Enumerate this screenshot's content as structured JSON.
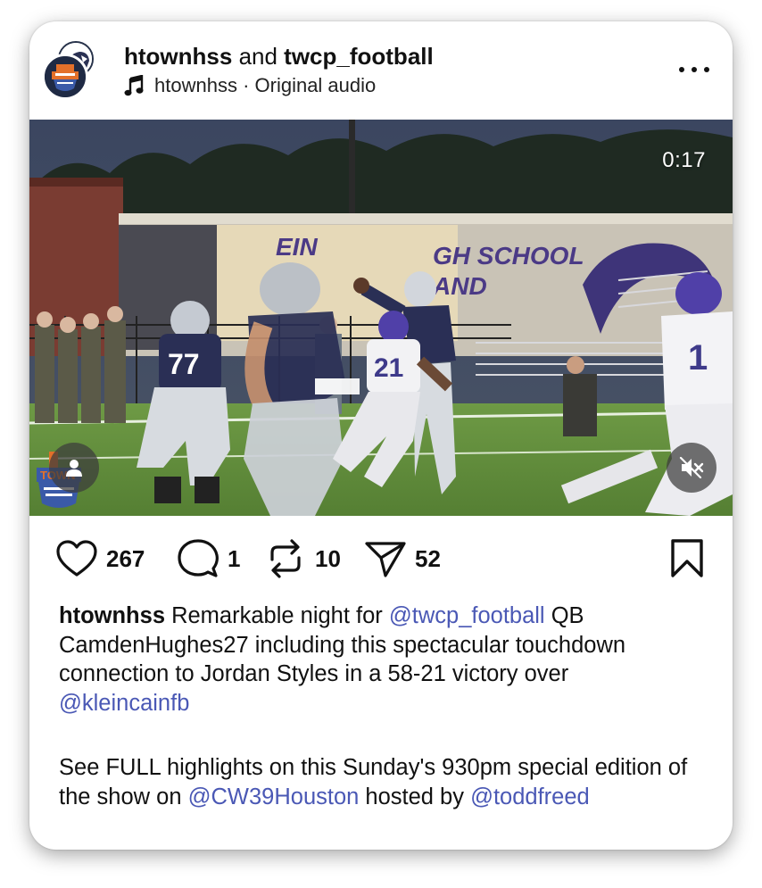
{
  "post": {
    "author_primary": "htownhss",
    "author_joiner": " and ",
    "author_secondary": "twcp_football",
    "audio_owner": "htownhss",
    "audio_sep": " · ",
    "audio_label": "Original audio"
  },
  "video": {
    "timer": "0:17",
    "overlay_signs": [
      "EIN",
      "GH SCHOOL",
      "AND"
    ],
    "jersey_numbers": [
      "77",
      "21",
      "1"
    ]
  },
  "actions": {
    "likes": "267",
    "comments": "1",
    "reposts": "10",
    "shares": "52"
  },
  "caption": {
    "username": "htownhss",
    "text_1": " Remarkable night for ",
    "mention_1": "@twcp_football",
    "text_2": " QB CamdenHughes27 including this spectacular touchdown connection to Jordan Styles in a 58-21 victory over ",
    "mention_2": "@kleincainfb",
    "text_3": "See FULL highlights on this Sunday's 930pm special edition of the show on ",
    "mention_3": "@CW39Houston",
    "text_4": " hosted by ",
    "mention_4": "@toddfreed"
  },
  "colors": {
    "mention": "#4a58b5",
    "text": "#111111",
    "field": "#5c8a3a",
    "jersey_navy": "#2a2f55"
  },
  "icons": [
    "music-note-icon",
    "more-options-icon",
    "user-icon",
    "mute-icon",
    "heart-icon",
    "comment-icon",
    "repost-icon",
    "share-icon",
    "bookmark-icon"
  ]
}
